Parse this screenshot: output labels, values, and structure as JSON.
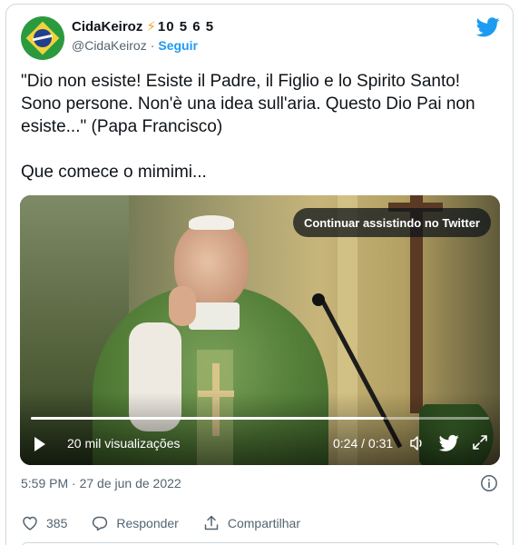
{
  "user": {
    "display_name": "CidaKeiroz",
    "name_suffix": "10 5 6 5",
    "handle": "@CidaKeiroz",
    "separator": "·",
    "follow_label": "Seguir"
  },
  "tweet": {
    "paragraph1": "\"Dio non esiste! Esiste il Padre, il Figlio e lo Spirito Santo! Sono persone. Non'è una idea sull'aria. Questo Dio Pai non esiste...\" (Papa Francisco)",
    "paragraph2": "Que comece o mimimi..."
  },
  "video": {
    "continue_label": "Continuar assistindo no Twitter",
    "views_label": "20 mil visualizações",
    "time_label": "0:24 / 0:31",
    "progress_fraction": 0.77
  },
  "meta": {
    "timestamp": "5:59 PM · 27 de jun de 2022"
  },
  "actions": {
    "like_count": "385",
    "reply_label": "Responder",
    "share_label": "Compartilhar"
  },
  "colors": {
    "accent": "#1d9bf0",
    "muted": "#536471",
    "border": "#cfd9de",
    "bolt": "#f5a623"
  },
  "icons": [
    "twitter-bird-icon",
    "lightning-bolt-icon",
    "play-icon",
    "volume-icon",
    "fullscreen-icon",
    "info-icon",
    "heart-icon",
    "reply-bubble-icon",
    "share-icon"
  ]
}
